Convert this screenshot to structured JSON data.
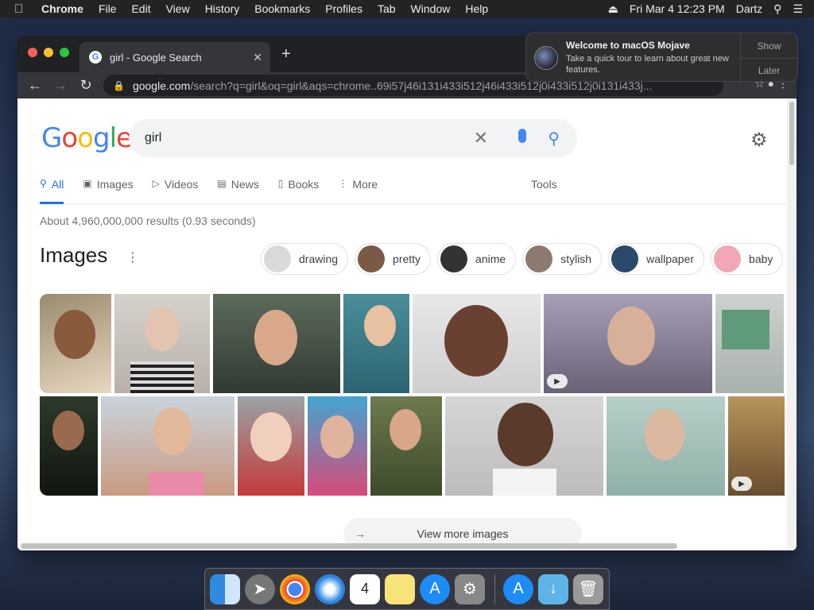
{
  "menubar": {
    "apple": "",
    "app": "Chrome",
    "items": [
      "File",
      "Edit",
      "View",
      "History",
      "Bookmarks",
      "Profiles",
      "Tab",
      "Window",
      "Help"
    ],
    "datetime": "Fri Mar 4  12:23 PM",
    "user": "Dartz"
  },
  "notification": {
    "title": "Welcome to macOS Mojave",
    "body": "Take a quick tour to learn about great new features.",
    "show": "Show",
    "later": "Later"
  },
  "browser": {
    "tab_title": "girl - Google Search",
    "url_host": "google.com",
    "url_path": "/search?q=girl&oq=girl&aqs=chrome..69i57j46i131i433i512j46i433i512j0i433i512j0i131i433j..."
  },
  "search": {
    "logo": "Google",
    "query": "girl"
  },
  "tabs": [
    "All",
    "Images",
    "Videos",
    "News",
    "Books",
    "More"
  ],
  "tools": "Tools",
  "stats": "About 4,960,000,000 results (0.93 seconds)",
  "images_heading": "Images",
  "chips": [
    {
      "label": "drawing",
      "color": "#d9d9d9"
    },
    {
      "label": "pretty",
      "color": "#7a5a45"
    },
    {
      "label": "anime",
      "color": "#333333"
    },
    {
      "label": "stylish",
      "color": "#8c7a70"
    },
    {
      "label": "wallpaper",
      "color": "#2b4a6b"
    },
    {
      "label": "baby",
      "color": "#f1a7b5"
    }
  ],
  "view_more": "View more images",
  "colors": {
    "google_blue": "#4285f4",
    "active_tab": "#1a73e8"
  }
}
